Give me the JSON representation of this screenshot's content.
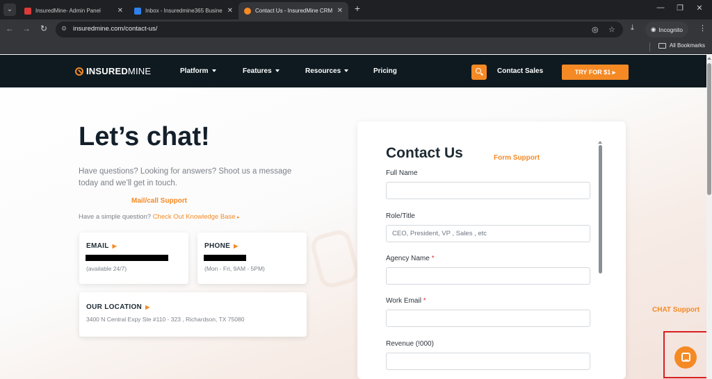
{
  "browser": {
    "tabs": [
      {
        "title": "InsuredMine- Admin Panel",
        "favicon_color": "#dd3a3a",
        "active": false
      },
      {
        "title": "Inbox - Insuredmine365 Busine",
        "favicon_color": "#2f80ed",
        "active": false
      },
      {
        "title": "Contact Us - InsuredMine CRM",
        "favicon_color": "#f58a25",
        "active": true
      }
    ],
    "new_tab_icon": "+",
    "url": "insuredmine.com/contact-us/",
    "incognito_label": "Incognito",
    "all_bookmarks_label": "All Bookmarks"
  },
  "site_nav": {
    "logo_bold": "INSURED",
    "logo_light": "MINE",
    "links": [
      "Platform",
      "Features",
      "Resources",
      "Pricing"
    ],
    "contact_sales": "Contact Sales",
    "cta": "TRY FOR $1",
    "accent_color": "#f58a25"
  },
  "hero": {
    "title": "Let’s chat!",
    "subtitle": "Have questions? Looking for answers? Shoot us a message today and we’ll get in touch.",
    "kb_prefix": "Have a simple question?",
    "kb_link": "Check Out Knowledge Base"
  },
  "annotations": {
    "mail_call": "Mail/call Support",
    "form": "Form Support",
    "chat": "CHAT Support"
  },
  "cards": {
    "email": {
      "heading": "EMAIL",
      "note": "(available 24/7)"
    },
    "phone": {
      "heading": "PHONE",
      "note": "(Mon - Fri, 9AM - 5PM)"
    },
    "location": {
      "heading": "OUR LOCATION",
      "address": "3400 N Central Expy Ste #110 - 323 , Richardson, TX 75080"
    }
  },
  "form": {
    "title": "Contact Us",
    "fields": {
      "full_name": {
        "label": "Full Name",
        "value": "",
        "required": false
      },
      "role": {
        "label": "Role/Title",
        "placeholder": "CEO, President, VP , Sales , etc",
        "required": false
      },
      "agency": {
        "label": "Agency Name",
        "value": "",
        "required": true
      },
      "email": {
        "label": "Work Email",
        "value": "",
        "required": true
      },
      "revenue": {
        "label": "Revenue (!000)",
        "value": "",
        "required": false
      }
    },
    "required_marker": "*"
  }
}
